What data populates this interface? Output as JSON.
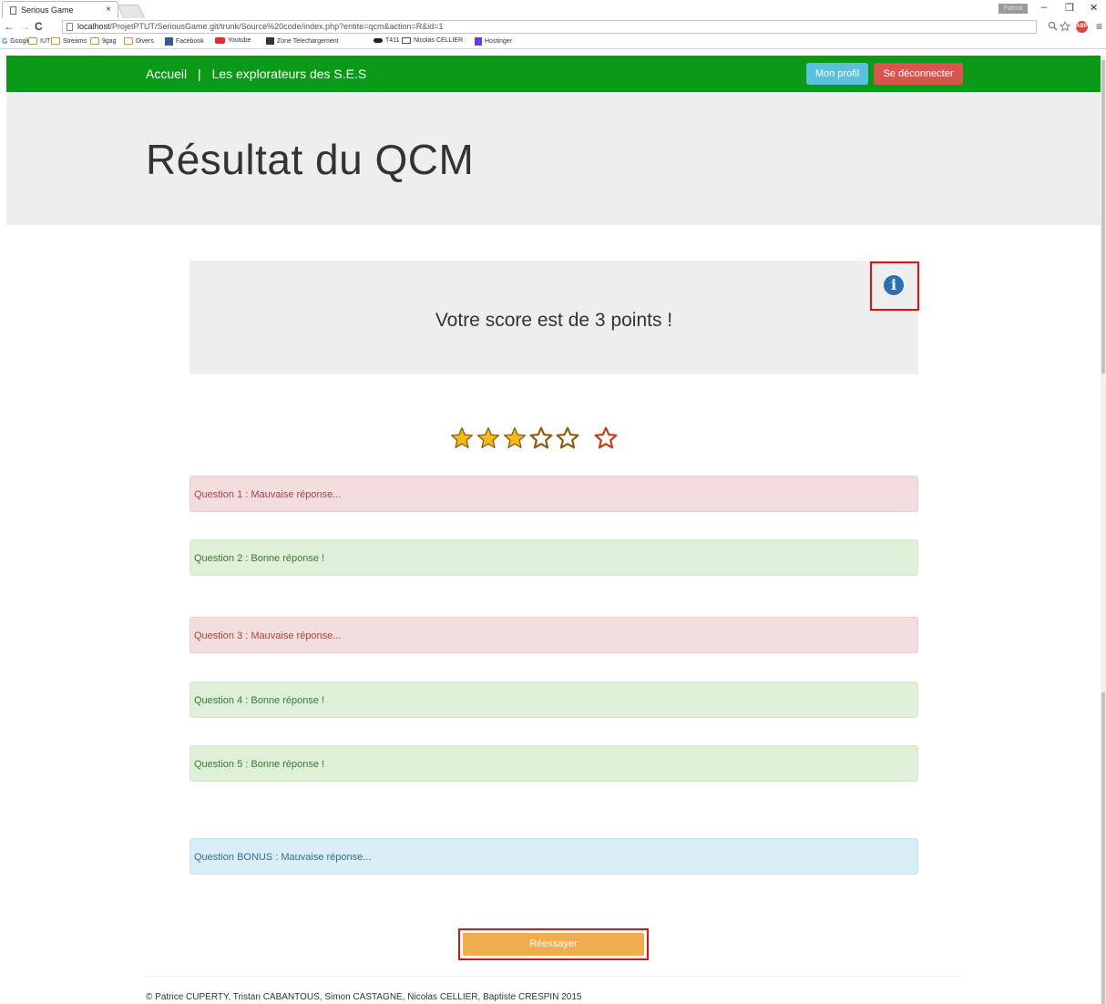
{
  "browser": {
    "tab_title": "Serious Game",
    "tab_close": "×",
    "profile_label": "Patrick",
    "url_host": "localhost",
    "url_path": "/ProjetPTUT/SeriousGame.git/trunk/Source%20code/index.php?entite=qcm&action=R&id=1",
    "bookmarks": [
      "Google",
      "IUT",
      "Streams",
      "9gag",
      "Divers",
      "Facebook",
      "Youtube",
      "Zone Telechargement",
      "T411",
      "Nicolas CELLIER",
      "Hostinger"
    ],
    "window_controls": [
      "–",
      "❐",
      "✕"
    ],
    "nav_glyphs": [
      "←",
      "→",
      "C"
    ],
    "addr_icons": [
      "search-zoom-icon",
      "star-bookmark-icon"
    ],
    "menu_glyph": "≡",
    "abp": "ABP"
  },
  "navbar": {
    "home": "Accueil",
    "separator": "|",
    "site_name": "Les explorateurs des S.E.S",
    "profile_button": "Mon profil",
    "logout_button": "Se déconnecter"
  },
  "page": {
    "title": "Résultat du QCM"
  },
  "score": {
    "text": "Votre score est de 3 points !",
    "info_glyph": "i",
    "stars_filled": 3,
    "stars_total": 5,
    "bonus_star_obtained": false
  },
  "colors": {
    "navbar": "#0b9a17",
    "star_fill": "#f5b81a",
    "star_outline": "#8a5a12",
    "bonus_star_outline": "#c63a17"
  },
  "questions": [
    {
      "label": "Question 1 : Mauvaise réponse...",
      "status": "danger"
    },
    {
      "label": "Question 2 : Bonne réponse !",
      "status": "success"
    },
    {
      "label": "Question 3 : Mauvaise réponse...",
      "status": "danger"
    },
    {
      "label": "Question 4 : Bonne réponse !",
      "status": "success"
    },
    {
      "label": "Question 5 : Bonne réponse !",
      "status": "success"
    },
    {
      "label": "Question BONUS : Mauvaise réponse...",
      "status": "info"
    }
  ],
  "retry_button": "Réessayer",
  "footer": "© Patrice CUPERTY, Tristan CABANTOUS, Simon CASTAGNE, Nicolas CELLIER, Baptiste CRESPIN 2015"
}
